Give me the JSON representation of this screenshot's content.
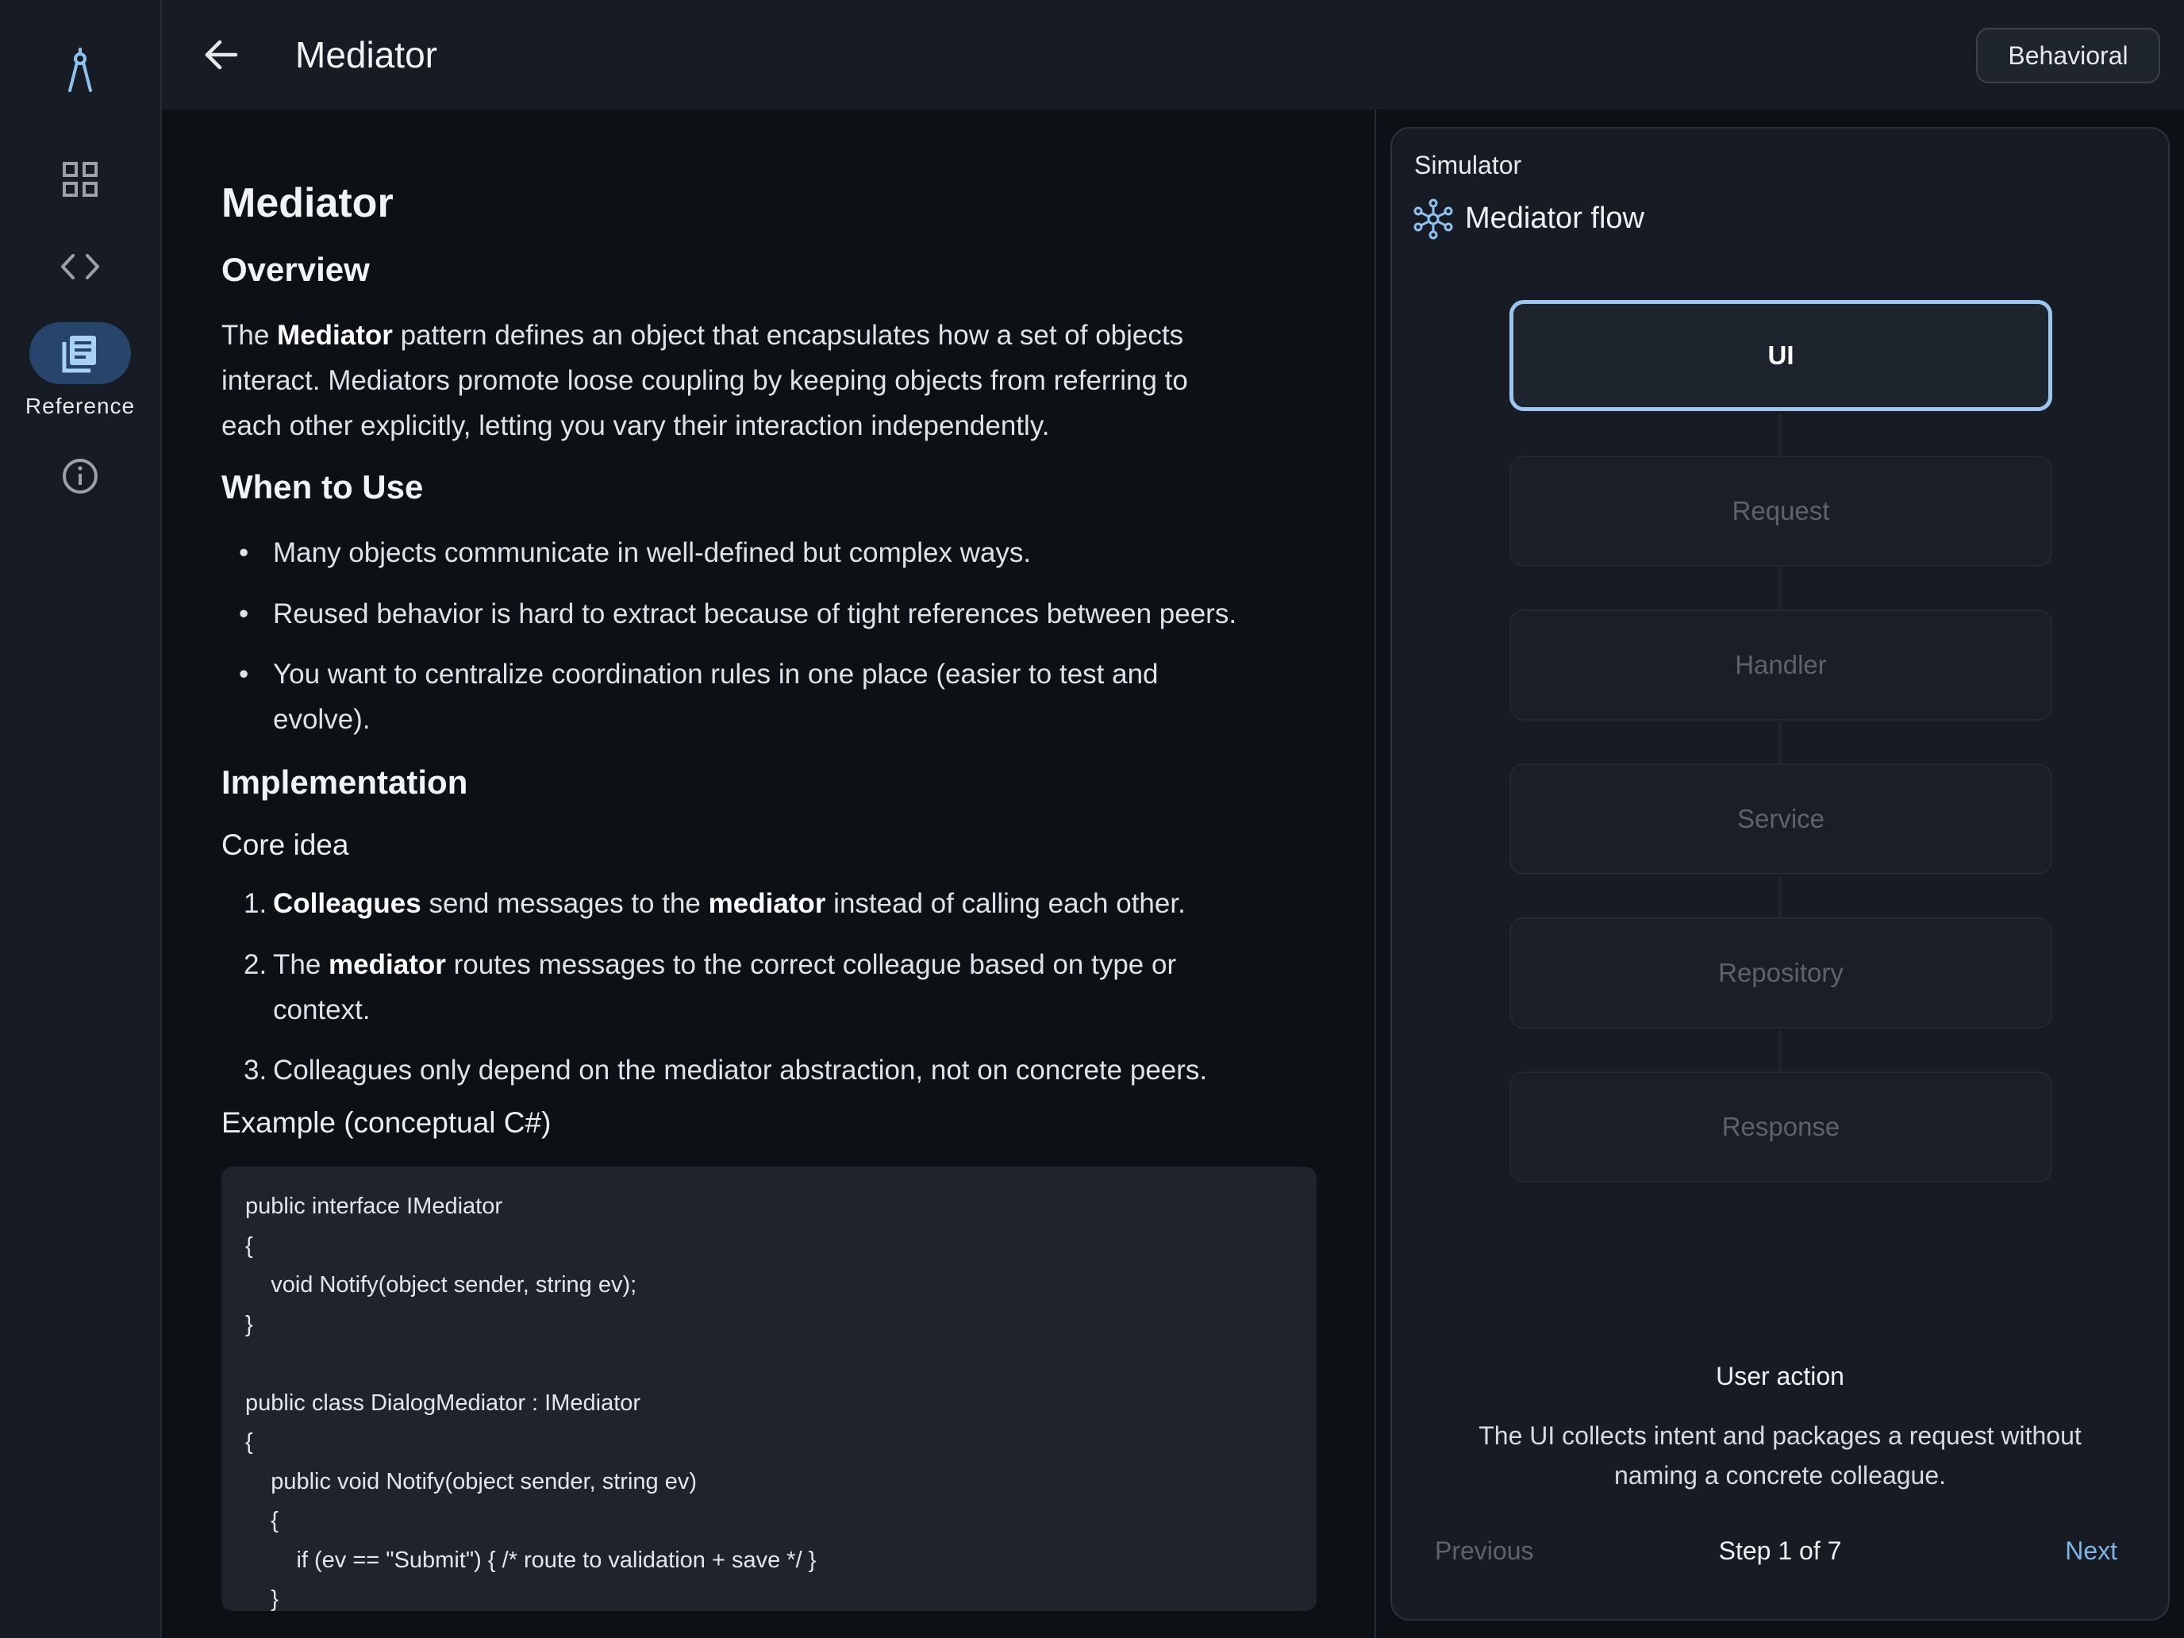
{
  "colors": {
    "background": "#0d1116",
    "surface": "#171c24",
    "accent": "#9cc6ee",
    "link": "#7fb4e6",
    "nav_active": "#27456a"
  },
  "rail": {
    "items": [
      {
        "icon": "compass-logo-icon"
      },
      {
        "icon": "grid-icon"
      },
      {
        "icon": "code-icon"
      },
      {
        "icon": "article-icon",
        "label": "Reference",
        "active": true
      },
      {
        "icon": "info-icon"
      }
    ]
  },
  "header": {
    "back_icon": "arrow-back-icon",
    "title": "Mediator",
    "category": "Behavioral"
  },
  "article": {
    "title": "Mediator",
    "overview_heading": "Overview",
    "overview": {
      "pre": "The ",
      "bold": "Mediator",
      "line1_rest": " pattern defines an object that encapsulates how a set of objects",
      "line2": "interact. Mediators promote loose coupling by keeping objects from referring to",
      "line3": "each other explicitly, letting you vary their interaction independently."
    },
    "when_heading": "When to Use",
    "when_items": [
      {
        "lines": [
          "Many objects communicate in well-defined but complex ways."
        ]
      },
      {
        "lines": [
          "Reused behavior is hard to extract because of tight references between peers."
        ]
      },
      {
        "lines": [
          "You want to centralize coordination rules in one place (easier to test and",
          "evolve)."
        ]
      }
    ],
    "impl_heading": "Implementation",
    "core_idea": "Core idea",
    "steps": [
      {
        "number": "1.",
        "b1": "Colleagues",
        "t1": " send messages to the ",
        "b2": "mediator",
        "t2": " instead of calling each other."
      },
      {
        "number": "2.",
        "t0": "The ",
        "b1": "mediator",
        "t1": " routes messages to the correct colleague based on type or",
        "line2": "context."
      },
      {
        "number": "3.",
        "t0": "Colleagues only depend on the mediator abstraction, not on concrete peers."
      }
    ],
    "example_heading": "Example (conceptual C#)",
    "code_lines": [
      "public interface IMediator",
      "{",
      "    void Notify(object sender, string ev);",
      "}",
      "",
      "public class DialogMediator : IMediator",
      "{",
      "    public void Notify(object sender, string ev)",
      "    {",
      "        if (ev == \"Submit\") { /* route to validation + save */ }",
      "    }"
    ]
  },
  "simulator": {
    "label": "Simulator",
    "title_icon": "hub-network-icon",
    "title": "Mediator flow",
    "nodes": [
      "UI",
      "Request",
      "Handler",
      "Service",
      "Repository",
      "Response"
    ],
    "active_node": "UI",
    "step_title": "User action",
    "step_desc_line1": "The UI collects intent and packages a request without",
    "step_desc_line2": "naming a concrete colleague.",
    "prev_label": "Previous",
    "step_indicator": "Step 1 of 7",
    "next_label": "Next"
  }
}
